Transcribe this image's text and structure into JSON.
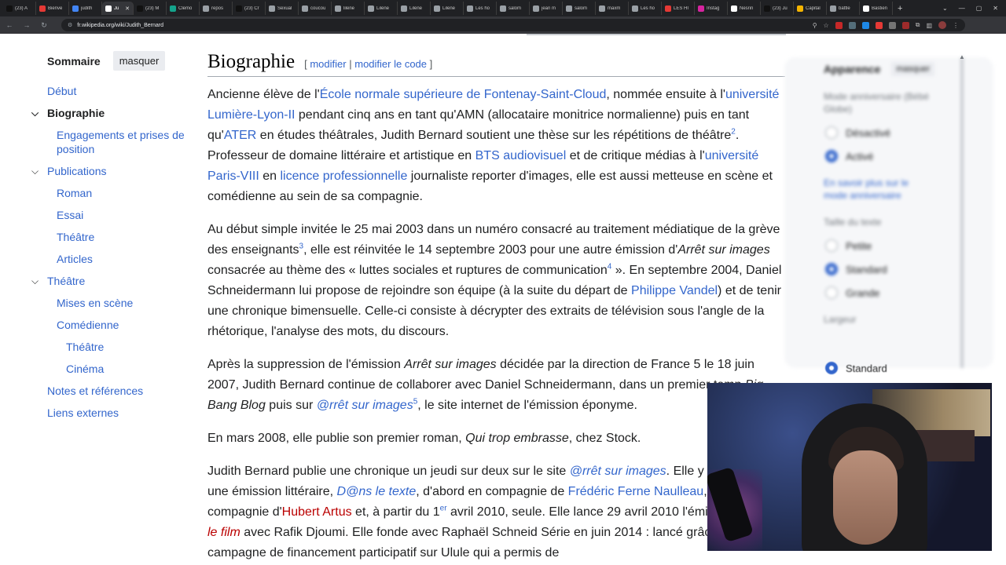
{
  "browser": {
    "tabs": [
      {
        "label": "(23) A",
        "color": "#111111"
      },
      {
        "label": "Bienve",
        "color": "#e53935"
      },
      {
        "label": "judith",
        "color": "#4285f4"
      },
      {
        "label": "Ju",
        "color": "#ffffff",
        "active": true
      },
      {
        "label": "(23) M",
        "color": "#111111"
      },
      {
        "label": "Clemo",
        "color": "#14a38b"
      },
      {
        "label": "repos",
        "color": "#9aa0a6"
      },
      {
        "label": "(23) Cr",
        "color": "#111111"
      },
      {
        "label": "Sexual",
        "color": "#9aa0a6"
      },
      {
        "label": "coucou",
        "color": "#9aa0a6"
      },
      {
        "label": "lilene",
        "color": "#9aa0a6"
      },
      {
        "label": "Lilene",
        "color": "#9aa0a6"
      },
      {
        "label": "Lilene",
        "color": "#9aa0a6"
      },
      {
        "label": "Lilene",
        "color": "#9aa0a6"
      },
      {
        "label": "Les ho",
        "color": "#9aa0a6"
      },
      {
        "label": "salom",
        "color": "#9aa0a6"
      },
      {
        "label": "jean m",
        "color": "#9aa0a6"
      },
      {
        "label": "salom",
        "color": "#9aa0a6"
      },
      {
        "label": "maxm",
        "color": "#9aa0a6"
      },
      {
        "label": "Les ho",
        "color": "#9aa0a6"
      },
      {
        "label": "LES HI",
        "color": "#e53935"
      },
      {
        "label": "Instag",
        "color": "#d6249f"
      },
      {
        "label": "Nesrin",
        "color": "#ffffff"
      },
      {
        "label": "(23) Ju",
        "color": "#111111"
      },
      {
        "label": "Capital",
        "color": "#f4b400"
      },
      {
        "label": "battle",
        "color": "#9aa0a6"
      },
      {
        "label": "Bastien",
        "color": "#ffffff"
      }
    ],
    "url": "fr.wikipedia.org/wiki/Judith_Bernard"
  },
  "toc": {
    "title": "Sommaire",
    "hide_label": "masquer",
    "items": [
      {
        "label": "Début",
        "level": 1
      },
      {
        "label": "Biographie",
        "level": 1,
        "active": true,
        "caret": true
      },
      {
        "label": "Engagements et prises de position",
        "level": 2
      },
      {
        "label": "Publications",
        "level": 1,
        "caret": true
      },
      {
        "label": "Roman",
        "level": 2
      },
      {
        "label": "Essai",
        "level": 2
      },
      {
        "label": "Théâtre",
        "level": 2
      },
      {
        "label": "Articles",
        "level": 2
      },
      {
        "label": "Théâtre",
        "level": 1,
        "caret": true
      },
      {
        "label": "Mises en scène",
        "level": 2
      },
      {
        "label": "Comédienne",
        "level": 2
      },
      {
        "label": "Théâtre",
        "level": 3
      },
      {
        "label": "Cinéma",
        "level": 3
      },
      {
        "label": "Notes et références",
        "level": 1
      },
      {
        "label": "Liens externes",
        "level": 1
      }
    ]
  },
  "section": {
    "title": "Biographie",
    "edit_open": "[",
    "edit_label": "modifier",
    "edit_sep": "|",
    "edit_code_label": "modifier le code",
    "edit_close": "]"
  },
  "paragraphs": [
    [
      {
        "t": "Ancienne élève de l'"
      },
      {
        "t": "École normale supérieure de Fontenay-Saint-Cloud",
        "link": true
      },
      {
        "t": ", nommée ensuite à l'"
      },
      {
        "t": "université Lumière-Lyon-II",
        "link": true
      },
      {
        "t": " pendant cinq ans en tant qu'AMN (allocataire monitrice normalienne) puis en tant qu'"
      },
      {
        "t": "ATER",
        "link": true
      },
      {
        "t": " en études théâtrales, Judith Bernard soutient une thèse sur les répétitions de théâtre"
      },
      {
        "t": "2",
        "sup": true
      },
      {
        "t": ". Professeur de domaine littéraire et artistique en "
      },
      {
        "t": "BTS audiovisuel",
        "link": true
      },
      {
        "t": " et de critique médias à l'"
      },
      {
        "t": "université Paris-VIII",
        "link": true
      },
      {
        "t": " en "
      },
      {
        "t": "licence professionnelle",
        "link": true
      },
      {
        "t": " journaliste reporter d'images, elle est aussi metteuse en scène et comédienne au sein de sa compagnie."
      }
    ],
    [
      {
        "t": "Au début simple invitée le 25 mai 2003 dans un numéro consacré au traitement médiatique de la grève des enseignants"
      },
      {
        "t": "3",
        "sup": true
      },
      {
        "t": ", elle est réinvitée le 14 septembre 2003 pour une autre émission d'"
      },
      {
        "t": "Arrêt sur images",
        "italic": true
      },
      {
        "t": " consacrée au thème des « luttes sociales et ruptures de communication"
      },
      {
        "t": "4",
        "sup": true
      },
      {
        "t": " ». En septembre 2004, Daniel Schneidermann lui propose de rejoindre son équipe (à la suite du départ de "
      },
      {
        "t": "Philippe Vandel",
        "link": true
      },
      {
        "t": ") et de tenir une chronique bimensuelle. Celle-ci consiste à décrypter des extraits de télévision sous l'angle de la rhétorique, l'analyse des mots, du discours."
      }
    ],
    [
      {
        "t": "Après la suppression de l'émission "
      },
      {
        "t": "Arrêt sur images",
        "italic": true
      },
      {
        "t": " décidée par la direction de France 5 le 18 juin 2007, Judith Bernard continue de collaborer avec Daniel Schneidermann, dans un premier temp"
      },
      {
        "t": " Big Bang Blog",
        "italic": true
      },
      {
        "t": " puis sur "
      },
      {
        "t": "@rrêt sur images",
        "link": true,
        "italic": true
      },
      {
        "t": "5",
        "sup": true
      },
      {
        "t": ", le site internet de l'émission éponyme."
      }
    ],
    [
      {
        "t": "En mars 2008, elle publie son premier roman, "
      },
      {
        "t": "Qui trop embrasse",
        "italic": true
      },
      {
        "t": ", chez Stock."
      }
    ],
    [
      {
        "t": "Judith Bernard publie une chronique un jeudi sur deux sur le site "
      },
      {
        "t": "@rrêt sur images",
        "link": true,
        "italic": true
      },
      {
        "t": ". Elle y mars 2009 une émission littéraire, "
      },
      {
        "t": "D@ns le texte",
        "link": true,
        "italic": true
      },
      {
        "t": ", d'abord en compagnie de "
      },
      {
        "t": "Frédéric Ferne",
        "link": true
      },
      {
        "t": " "
      },
      {
        "t": "Naulleau",
        "link": true
      },
      {
        "t": ", puis en compagnie d'"
      },
      {
        "t": "Hubert Artus",
        "link": true,
        "red": true
      },
      {
        "t": " et, à partir du 1"
      },
      {
        "t": "er",
        "sup": true
      },
      {
        "t": " avril 2010, seule. Elle lance 29 avril 2010 l'émission "
      },
      {
        "t": "D@ns le film",
        "link": true,
        "red": true,
        "italic": true
      },
      {
        "t": " avec Rafik Djoumi. Elle fonde avec Raphaël Schneid Série en juin 2014 : lancé grâce à une campagne de financement participatif sur Ulule qui a permis de"
      }
    ]
  ],
  "appearance": {
    "title": "Apparence",
    "hide_label": "masquer",
    "anniv_label": "Mode anniversaire (Bébé Globe)",
    "opt_off": "Désactivé",
    "opt_on": "Activé",
    "learn_more": "En savoir plus sur le mode anniversaire",
    "text_size_label": "Taille du texte",
    "size_small": "Petite",
    "size_standard": "Standard",
    "size_large": "Grande",
    "width_label": "Largeur",
    "width_standard": "Standard"
  },
  "colors": {
    "link": "#3366cc",
    "redlink": "#ba0000",
    "text": "#202122"
  }
}
